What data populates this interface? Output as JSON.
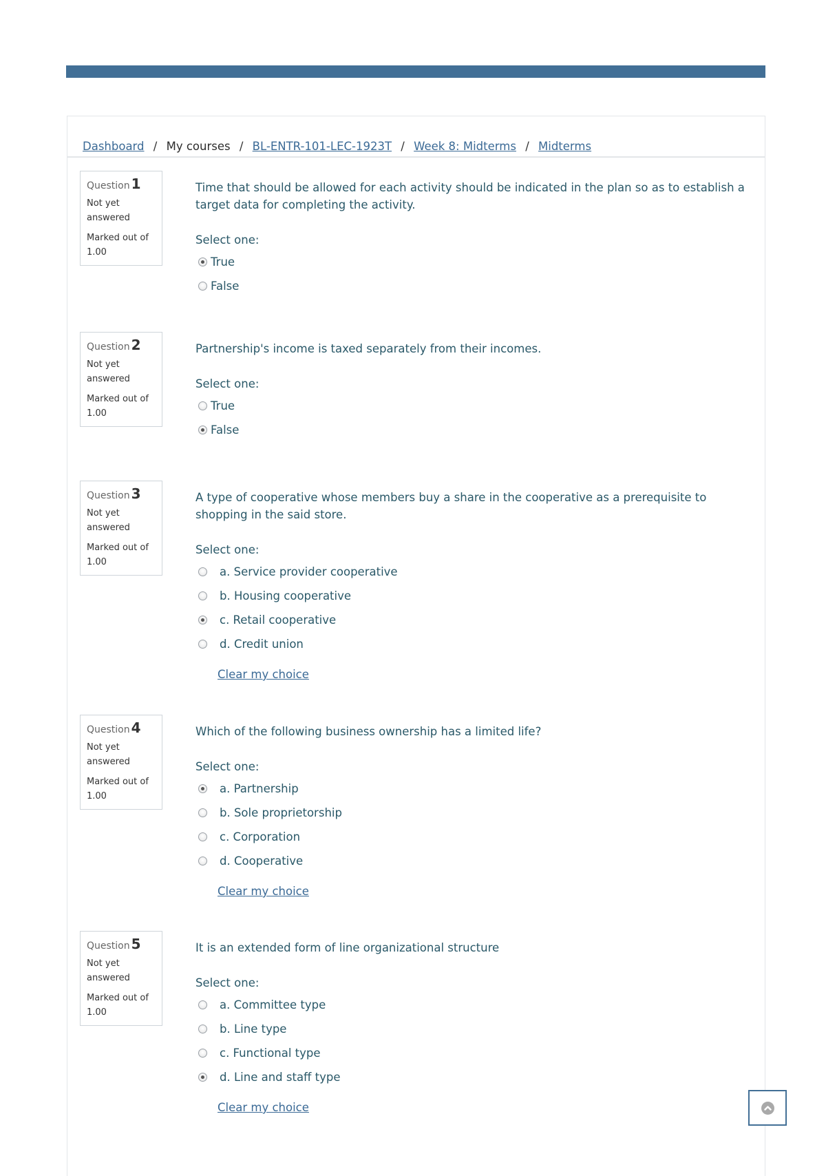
{
  "header": {
    "bar_color": "#426f96"
  },
  "breadcrumb": [
    {
      "label": "Dashboard",
      "link": true
    },
    {
      "label": "My courses",
      "link": false
    },
    {
      "label": "BL-ENTR-101-LEC-1923T",
      "link": true
    },
    {
      "label": "Week 8: Midterms",
      "link": true
    },
    {
      "label": "Midterms",
      "link": true
    }
  ],
  "breadcrumb_separator": "/",
  "questions": [
    {
      "label": "Question",
      "number": "1",
      "state": "Not yet answered",
      "grade": "Marked out of 1.00",
      "text": "Time that should be allowed for each activity should be indicated in the plan so as to establish a target data for completing the activity.",
      "prompt": "Select one:",
      "type": "truefalse",
      "options": [
        {
          "label": "True",
          "checked": true
        },
        {
          "label": "False",
          "checked": false
        }
      ],
      "clear_label": ""
    },
    {
      "label": "Question",
      "number": "2",
      "state": "Not yet answered",
      "grade": "Marked out of 1.00",
      "text": "Partnership's income is taxed separately from their incomes.",
      "prompt": "Select one:",
      "type": "truefalse",
      "options": [
        {
          "label": "True",
          "checked": false
        },
        {
          "label": "False",
          "checked": true
        }
      ],
      "clear_label": ""
    },
    {
      "label": "Question",
      "number": "3",
      "state": "Not yet answered",
      "grade": "Marked out of 1.00",
      "text": "A type of cooperative whose members buy a share in the cooperative as a prerequisite to shopping in the said store.",
      "prompt": "Select one:",
      "type": "multichoice",
      "options": [
        {
          "label": "a. Service provider cooperative",
          "checked": false
        },
        {
          "label": "b. Housing cooperative",
          "checked": false
        },
        {
          "label": "c. Retail cooperative",
          "checked": true
        },
        {
          "label": "d. Credit union",
          "checked": false
        }
      ],
      "clear_label": "Clear my choice"
    },
    {
      "label": "Question",
      "number": "4",
      "state": "Not yet answered",
      "grade": "Marked out of 1.00",
      "text": "Which of the following business ownership has a limited life?",
      "prompt": "Select one:",
      "type": "multichoice",
      "options": [
        {
          "label": "a. Partnership",
          "checked": true
        },
        {
          "label": "b. Sole proprietorship",
          "checked": false
        },
        {
          "label": "c. Corporation",
          "checked": false
        },
        {
          "label": "d. Cooperative",
          "checked": false
        }
      ],
      "clear_label": "Clear my choice"
    },
    {
      "label": "Question",
      "number": "5",
      "state": "Not yet answered",
      "grade": "Marked out of 1.00",
      "text": "It is an extended form of line organizational structure",
      "prompt": "Select one:",
      "type": "multichoice",
      "options": [
        {
          "label": "a. Committee type",
          "checked": false
        },
        {
          "label": "b. Line type",
          "checked": false
        },
        {
          "label": "c. Functional type",
          "checked": false
        },
        {
          "label": "d. Line and staff type",
          "checked": true
        }
      ],
      "clear_label": "Clear my choice"
    }
  ],
  "back_to_top": {
    "icon": "chevron-up-circle-icon"
  }
}
